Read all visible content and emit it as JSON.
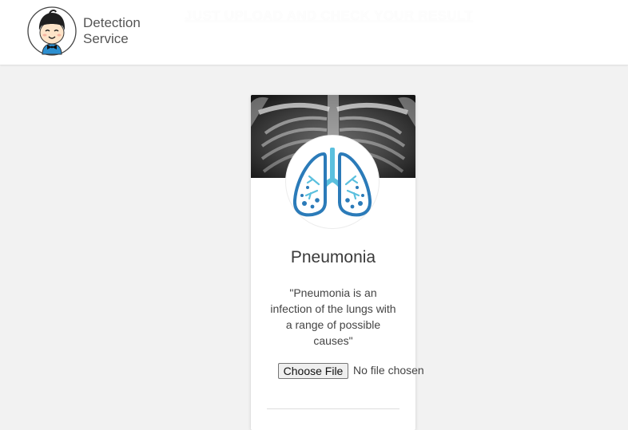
{
  "header": {
    "brand_line1": "Detection",
    "brand_line2": "Service",
    "tagline": "JUST UPLOAD AND CHECK YOUR RESULT",
    "logo_icon": "cartoon-boy-avatar-icon"
  },
  "card": {
    "banner_icon": "chest-xray-image",
    "lung_icon": "lungs-icon",
    "title": "Pneumonia",
    "description": "\"Pneumonia is an infection of the lungs with a range of possible causes\"",
    "file_button_label": "Choose File",
    "file_status": "No file chosen"
  },
  "colors": {
    "header_bg": "#ffffff",
    "page_bg": "#f2f2f2",
    "lung_blue": "#2b7bb9",
    "lung_light_blue": "#5bc0de"
  }
}
